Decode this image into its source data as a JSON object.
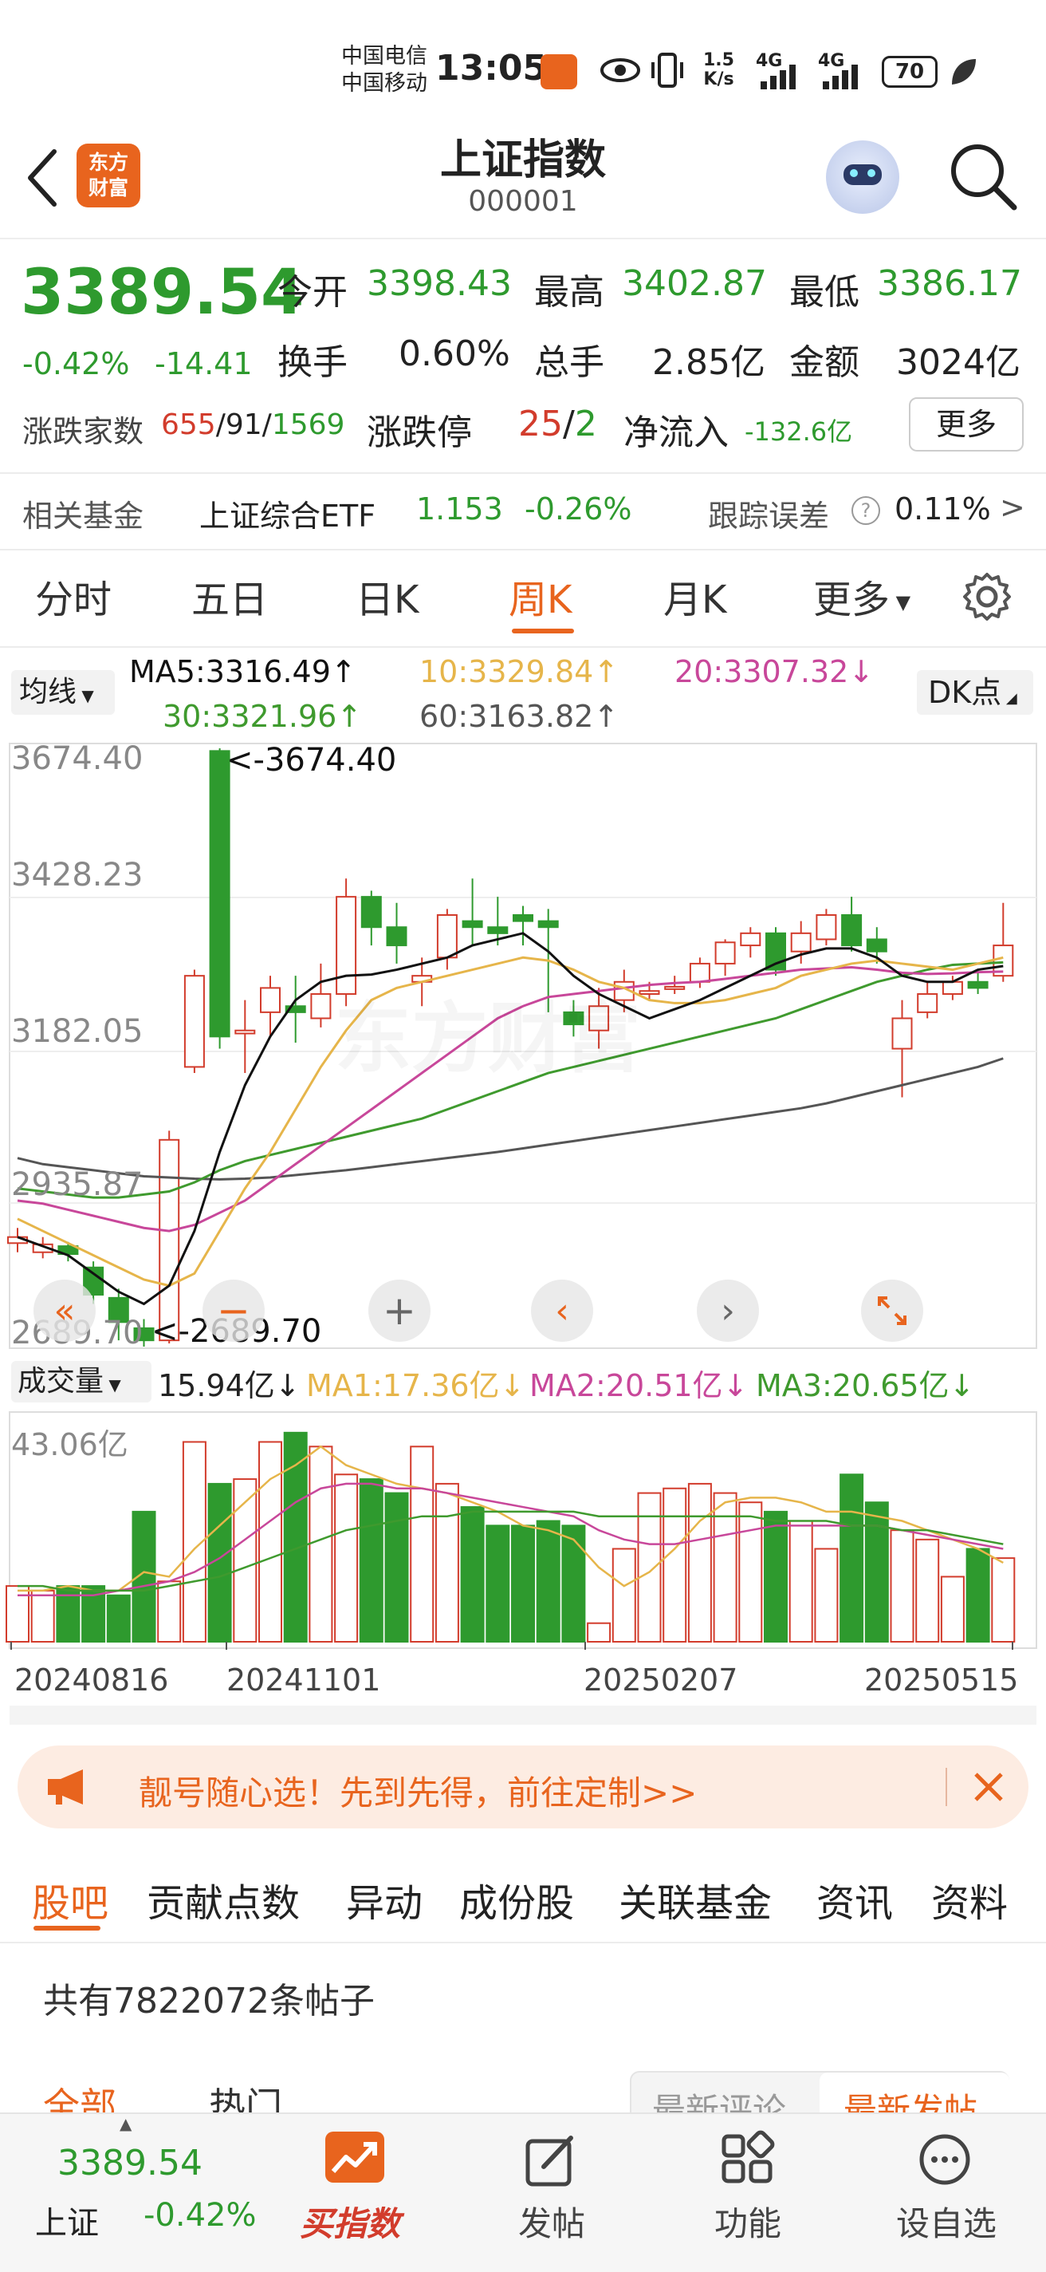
{
  "status": {
    "carrier1": "中国电信",
    "carrier2": "中国移动",
    "time": "13:05",
    "speed_top": "1.5",
    "speed_unit": "K/s",
    "net1": "4G",
    "net2": "4G",
    "battery": "70"
  },
  "header": {
    "title": "上证指数",
    "code": "000001",
    "logo_line1": "东方",
    "logo_line2": "财富"
  },
  "quote": {
    "price": "3389.54",
    "pct": "-0.42%",
    "chg": "-14.41",
    "open_label": "今开",
    "open": "3398.43",
    "high_label": "最高",
    "high": "3402.87",
    "low_label": "最低",
    "low": "3386.17",
    "turnover_label": "换手",
    "turnover": "0.60%",
    "volume_label": "总手",
    "volume": "2.85亿",
    "amount_label": "金额",
    "amount": "3024亿",
    "breadth_label": "涨跌家数",
    "up": "655",
    "flat": "91",
    "down": "1569",
    "limit_label": "涨跌停",
    "limit_up": "25",
    "limit_down": "2",
    "netflow_label": "净流入",
    "netflow": "-132.6亿",
    "more": "更多"
  },
  "fund": {
    "label": "相关基金",
    "name": "上证综合ETF",
    "price": "1.153",
    "pct": "-0.26%",
    "err_label": "跟踪误差",
    "err": "0.11%"
  },
  "tabs": [
    "分时",
    "五日",
    "日K",
    "周K",
    "月K",
    "更多"
  ],
  "ma": {
    "selector": "均线",
    "ma5": "MA5:3316.49↑",
    "ma10": "10:3329.84↑",
    "ma20": "20:3307.32↓",
    "ma30": "30:3321.96↑",
    "ma60": "60:3163.82↑",
    "dk": "DK点"
  },
  "price_axis": [
    "3674.40",
    "3428.23",
    "3182.05",
    "2935.87",
    "2689.70"
  ],
  "max_label": "<-3674.40",
  "min_label": "<-2689.70",
  "watermark": "东方财富",
  "volume": {
    "selector": "成交量",
    "val": "15.94亿↓",
    "ma1": "MA1:17.36亿↓",
    "ma2": "MA2:20.51亿↓",
    "ma3": "MA3:20.65亿↓",
    "axis_top": "43.06亿"
  },
  "dates": [
    "20240816",
    "20241101",
    "20250207",
    "20250515"
  ],
  "promo": {
    "text": "靓号随心选！先到先得，前往定制>>"
  },
  "subtabs": [
    "股吧",
    "贡献点数",
    "异动",
    "成份股",
    "关联基金",
    "资讯",
    "资料"
  ],
  "posts": {
    "count_text": "共有7822072条帖子",
    "filter_all": "全部",
    "filter_hot": "热门",
    "sort_comment": "最新评论",
    "sort_post": "最新发帖"
  },
  "bottom": {
    "price": "3389.54",
    "name": "上证",
    "pct": "-0.42%",
    "buy": "买指数",
    "post": "发帖",
    "func": "功能",
    "watch": "设自选"
  },
  "colors": {
    "up": "#d23c2c",
    "down": "#2e9a2e",
    "accent": "#e8641e",
    "ma5": "#111111",
    "ma10": "#e6b54a",
    "ma20": "#c8479a",
    "ma30": "#3f9a2e",
    "ma60": "#555555"
  }
}
